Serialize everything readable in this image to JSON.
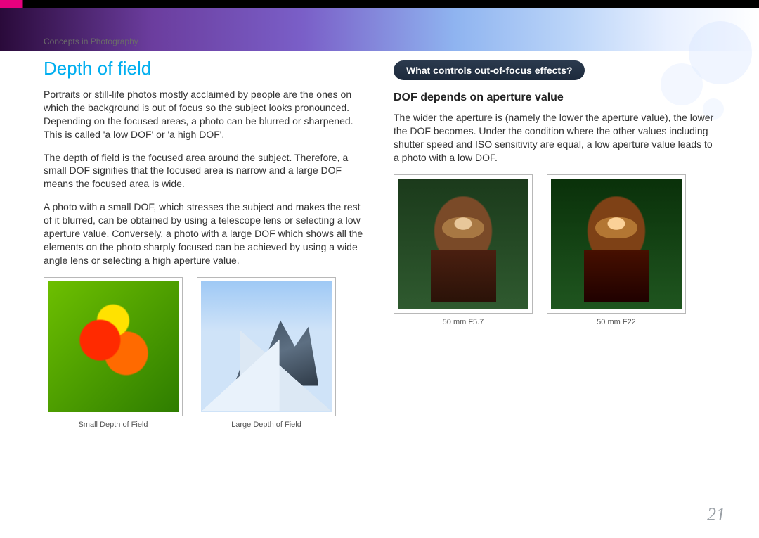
{
  "breadcrumb": "Concepts in Photography",
  "page_title": "Depth of field",
  "left": {
    "p1": "Portraits or still-life photos mostly acclaimed by people are the ones on which the background is out of focus so the subject looks pronounced. Depending on the focused areas, a photo can be blurred or sharpened. This is called 'a low DOF' or 'a high DOF'.",
    "p2": "The depth of field is the focused area around the subject. Therefore, a small DOF signifies that the focused area is narrow and a large DOF means the focused area is wide.",
    "p3": "A photo with a small DOF, which stresses the subject and makes the rest of it blurred, can be obtained by using a telescope lens or selecting a low aperture value. Conversely, a photo with a large DOF which shows all the elements on the photo sharply focused can be achieved by using a wide angle lens or selecting a high aperture value.",
    "captions": [
      "Small Depth of Field",
      "Large Depth of Field"
    ]
  },
  "right": {
    "pill": "What controls out-of-focus effects?",
    "heading": "DOF depends on aperture value",
    "p1": "The wider the aperture is (namely the lower the aperture value), the lower the DOF becomes. Under the condition where the other values including shutter speed and ISO sensitivity are equal, a low aperture value leads to a photo with a low DOF.",
    "captions": [
      "50 mm F5.7",
      "50 mm F22"
    ]
  },
  "page_number": "21"
}
